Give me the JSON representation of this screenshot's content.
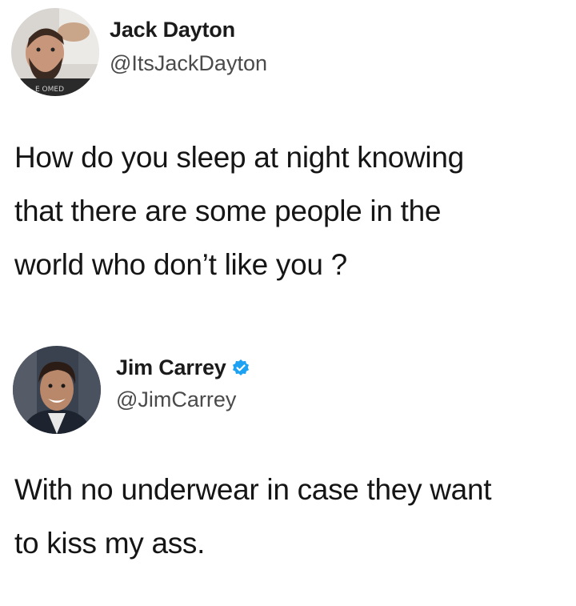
{
  "tweets": [
    {
      "author": {
        "name": "Jack Dayton",
        "handle": "@ItsJackDayton",
        "avatar": "avatar-photo-man-beard",
        "verified": false
      },
      "text_lines": [
        "How do you sleep at night knowing",
        "that there are some people in the",
        "world who don’t like you ?"
      ]
    },
    {
      "author": {
        "name": "Jim Carrey",
        "handle": "@JimCarrey",
        "avatar": "avatar-photo-jim-carrey",
        "verified": true,
        "verified_icon": "verified-badge-icon"
      },
      "text_lines": [
        "With no underwear in case they want",
        "to kiss my ass."
      ]
    }
  ],
  "colors": {
    "background": "#ffffff",
    "name_text": "#1b1b1b",
    "handle_text": "#4a4a4a",
    "body_text": "#151515",
    "verified_blue": "#1da1f2"
  }
}
